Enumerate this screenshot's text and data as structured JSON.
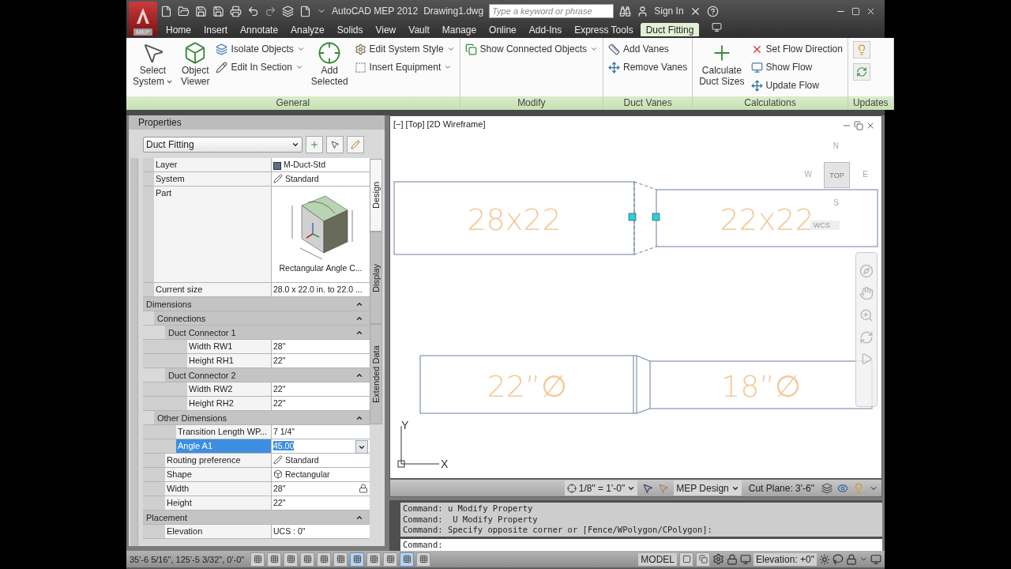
{
  "title_bar": {
    "app_button": "MEP",
    "title": "AutoCAD MEP 2012",
    "document": "Drawing1.dwg",
    "search": {
      "placeholder": "Type a keyword or phrase"
    },
    "sign_in": "Sign In"
  },
  "tabs": [
    {
      "label": "Home",
      "selected": false
    },
    {
      "label": "Insert",
      "selected": false
    },
    {
      "label": "Annotate",
      "selected": false
    },
    {
      "label": "Analyze",
      "selected": false
    },
    {
      "label": "Solids",
      "selected": false
    },
    {
      "label": "View",
      "selected": false
    },
    {
      "label": "Vault",
      "selected": false
    },
    {
      "label": "Manage",
      "selected": false
    },
    {
      "label": "Online",
      "selected": false
    },
    {
      "label": "Add-Ins",
      "selected": false
    },
    {
      "label": "Express Tools",
      "selected": false
    },
    {
      "label": "Duct Fitting",
      "selected": true
    }
  ],
  "ribbon": {
    "panels": [
      {
        "title": "General",
        "tools": [
          {
            "kind": "large",
            "lines": [
              "Select",
              "System"
            ],
            "dropdown": true
          },
          {
            "kind": "large",
            "lines": [
              "Object",
              "Viewer"
            ],
            "dropdown": false
          },
          {
            "kind": "small",
            "label": "Isolate Objects",
            "dropdown": true
          },
          {
            "kind": "small",
            "label": "Edit In Section",
            "dropdown": true
          },
          {
            "kind": "large",
            "lines": [
              "Add",
              "Selected"
            ],
            "dropdown": false
          },
          {
            "kind": "small",
            "label": "Edit System Style",
            "dropdown": true
          },
          {
            "kind": "small",
            "label": "Insert Equipment",
            "dropdown": true
          }
        ]
      },
      {
        "title": "Modify",
        "tools": [
          {
            "kind": "small",
            "label": "Show Connected Objects",
            "dropdown": true
          }
        ]
      },
      {
        "title": "Duct Vanes",
        "tools": [
          {
            "kind": "small",
            "label": "Add Vanes",
            "dropdown": false
          },
          {
            "kind": "small",
            "label": "Remove Vanes",
            "dropdown": false
          }
        ]
      },
      {
        "title": "Calculations",
        "tools": [
          {
            "kind": "large",
            "lines": [
              "Calculate",
              "Duct Sizes"
            ],
            "dropdown": false
          },
          {
            "kind": "small",
            "label": "Set Flow Direction",
            "dropdown": false
          },
          {
            "kind": "small",
            "label": "Show Flow",
            "dropdown": false
          },
          {
            "kind": "small",
            "label": "Update Flow",
            "dropdown": false
          }
        ]
      },
      {
        "title": "Updates",
        "tools": [
          {
            "kind": "icon"
          },
          {
            "kind": "icon"
          }
        ]
      }
    ]
  },
  "properties": {
    "title": "Properties",
    "selector": "Duct Fitting",
    "side_tabs": [
      {
        "label": "Design",
        "selected": true
      },
      {
        "label": "Display",
        "selected": false
      },
      {
        "label": "Extended Data",
        "selected": false
      }
    ],
    "rows": [
      {
        "kind": "layer",
        "label": "Layer",
        "value": "M-Duct-Std",
        "selected": false
      },
      {
        "kind": "style",
        "label": "System",
        "value": "Standard",
        "selected": false
      },
      {
        "kind": "part",
        "label": "Part",
        "caption": "Rectangular Angle C...",
        "selected": false
      },
      {
        "kind": "text",
        "label": "Current size",
        "value": "28.0 x 22.0 in. to 22.0 ...",
        "selected": false
      },
      {
        "kind": "group",
        "label": "Dimensions",
        "expanded": true,
        "children": [
          {
            "kind": "group",
            "label": "Connections",
            "expanded": true,
            "children": [
              {
                "kind": "group",
                "label": "Duct Connector 1",
                "expanded": true,
                "children": [
                  {
                    "kind": "text",
                    "label": "Width RW1",
                    "value": "28\"",
                    "selected": false
                  },
                  {
                    "kind": "text",
                    "label": "Height RH1",
                    "value": "22\"",
                    "selected": false
                  }
                ]
              },
              {
                "kind": "group",
                "label": "Duct Connector 2",
                "expanded": true,
                "children": [
                  {
                    "kind": "text",
                    "label": "Width RW2",
                    "value": "22\"",
                    "selected": false
                  },
                  {
                    "kind": "text",
                    "label": "Height RH2",
                    "value": "22\"",
                    "selected": false
                  }
                ]
              }
            ]
          },
          {
            "kind": "group",
            "label": "Other Dimensions",
            "expanded": true,
            "children": [
              {
                "kind": "text",
                "label": "Transition Length WP...",
                "value": "7 1/4\"",
                "selected": false
              },
              {
                "kind": "text",
                "label": "Angle A1",
                "value": "45.00",
                "selected": true
              }
            ]
          },
          {
            "kind": "style",
            "label": "Routing preference",
            "value": "Standard",
            "selected": false
          },
          {
            "kind": "shape",
            "label": "Shape",
            "value": "Rectangular",
            "selected": false
          },
          {
            "kind": "lock",
            "label": "Width",
            "value": "28\"",
            "selected": false
          },
          {
            "kind": "text",
            "label": "Height",
            "value": "22\"",
            "selected": false
          }
        ]
      },
      {
        "kind": "group",
        "label": "Placement",
        "expanded": true,
        "children": [
          {
            "kind": "text",
            "label": "Elevation",
            "value": "UCS : 0\"",
            "selected": false
          }
        ]
      }
    ]
  },
  "viewport": {
    "label": "[−] [Top] [2D Wireframe]",
    "view_cube": {
      "north": "N",
      "west": "W",
      "face": "TOP",
      "east": "E",
      "south": "S",
      "ucs": "WCS"
    },
    "ducts": [
      {
        "label": "28x22"
      },
      {
        "label": "22x22"
      },
      {
        "label": "22”∅"
      },
      {
        "label": "18”∅"
      }
    ],
    "transitions": [
      {
        "selected": true
      },
      {
        "selected": false
      }
    ],
    "axes": {
      "x": "X",
      "y": "Y"
    }
  },
  "viewport_status": {
    "scale": "1/8\" = 1'-0\"",
    "display_configuration": "MEP Design",
    "cut_plane": "Cut Plane: 3'-6\""
  },
  "command_line": {
    "history": [
      "Command: u Modify Property",
      "Command:  U Modify Property",
      "Command: Specify opposite corner or [Fence/WPolygon/CPolygon]:"
    ],
    "prompt": "Command:"
  },
  "status_bar": {
    "coordinates": "35'-6 5/16\", 125'-5 3/32\", 0'-0\"",
    "toggles": [
      {
        "on": false
      },
      {
        "on": false
      },
      {
        "on": false
      },
      {
        "on": false
      },
      {
        "on": false
      },
      {
        "on": false
      },
      {
        "on": true
      },
      {
        "on": false
      },
      {
        "on": false
      },
      {
        "on": true
      },
      {
        "on": false
      }
    ],
    "space": "MODEL",
    "elevation": "Elevation: +0\""
  }
}
